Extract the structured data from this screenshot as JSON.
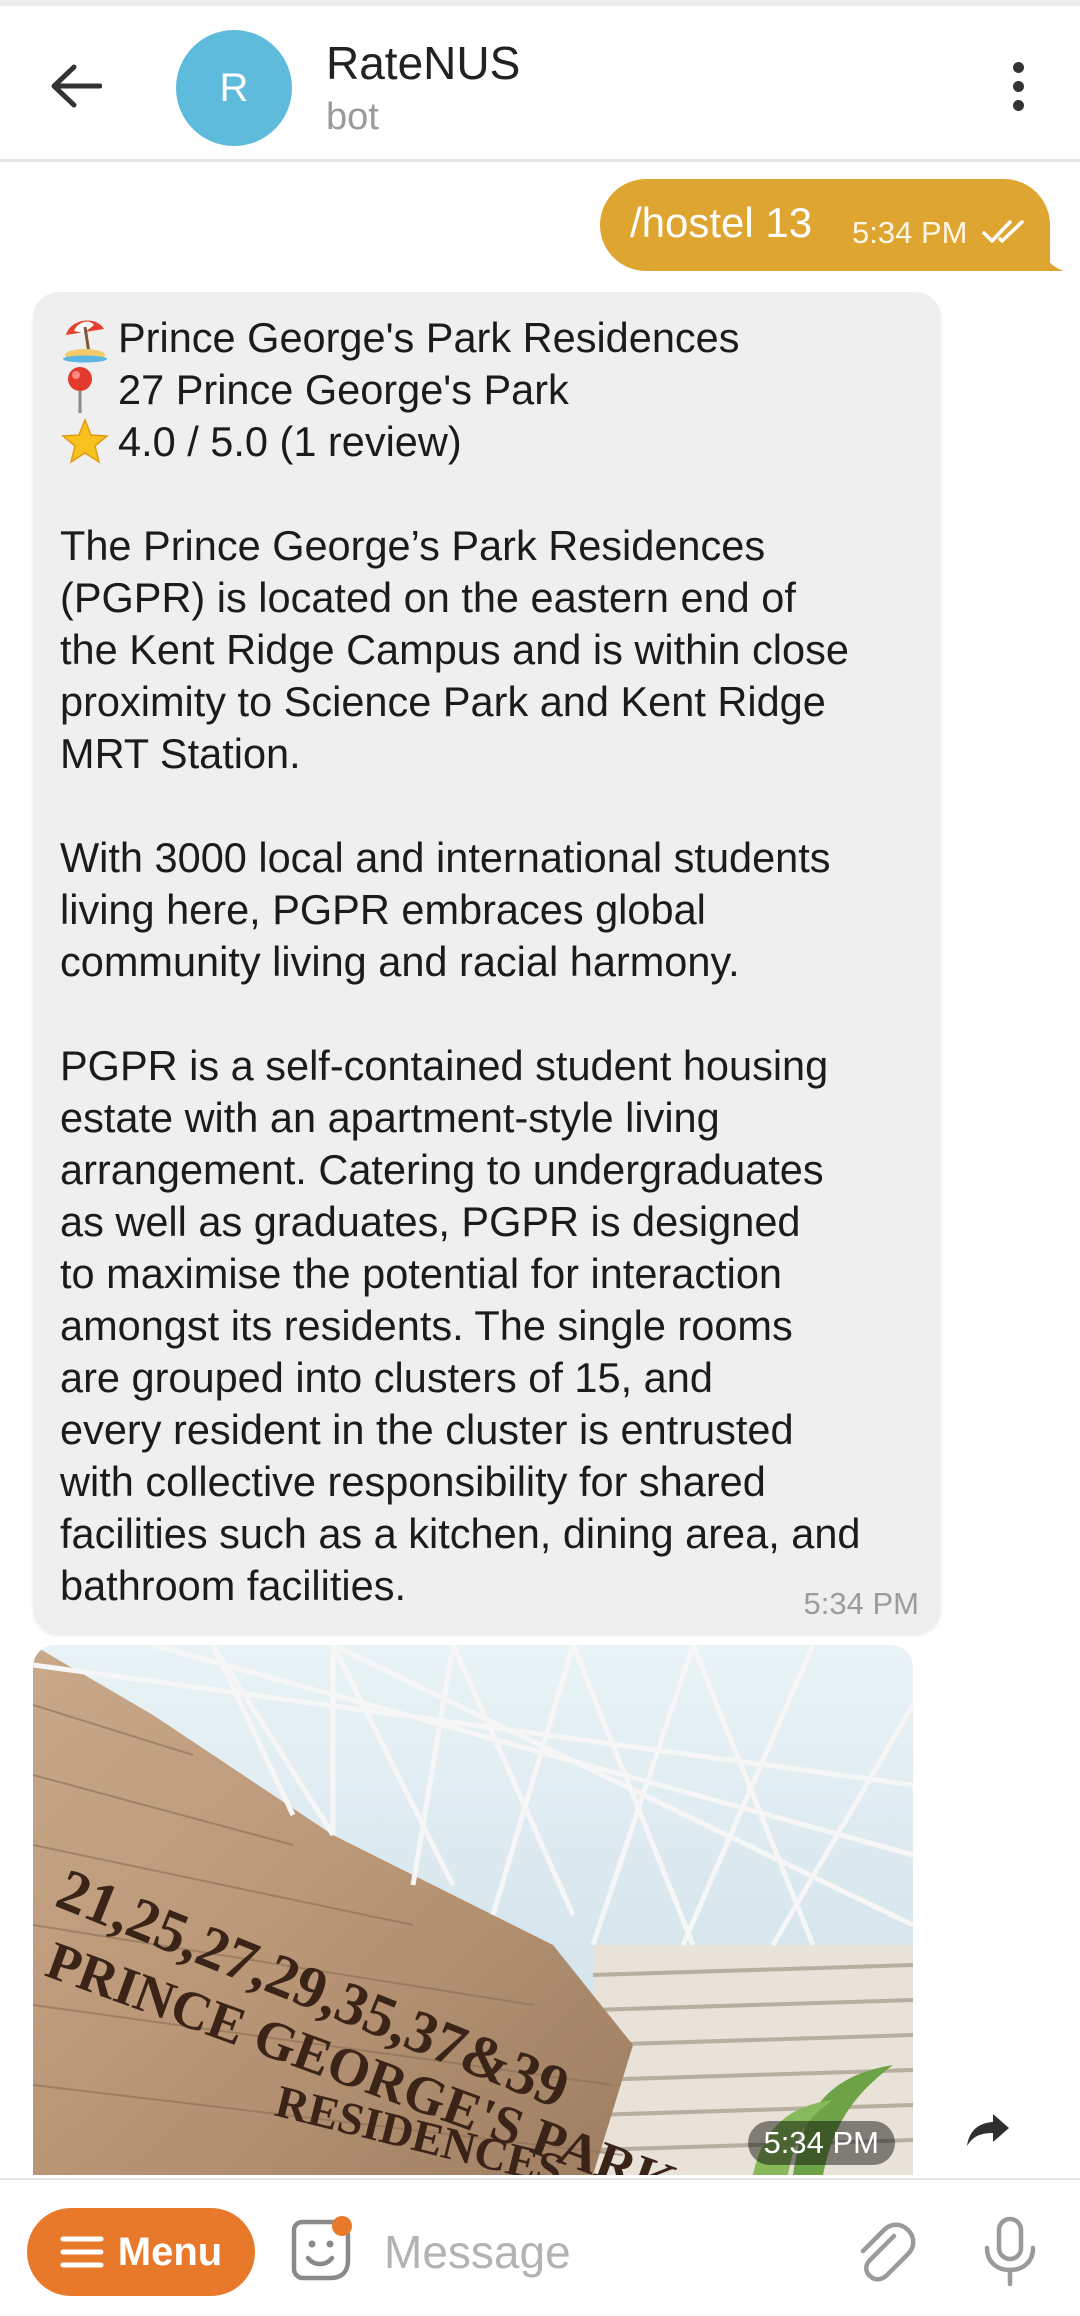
{
  "header": {
    "back_icon": "arrow-left-icon",
    "avatar_letter": "R",
    "avatar_color": "#5fbbdc",
    "title": "RateNUS",
    "subtitle": "bot",
    "more_icon": "more-vertical-icon"
  },
  "messages": {
    "outgoing": {
      "text": "/hostel 13",
      "time": "5:34 PM",
      "status_icon": "double-check-icon",
      "bubble_color": "#dfa531"
    },
    "incoming": {
      "name_emoji": "beach-umbrella-emoji",
      "name": "Prince George's Park Residences",
      "address_emoji": "round-pushpin-emoji",
      "address": "27 Prince George's Park",
      "rating_emoji": "star-emoji",
      "rating": "4.0 / 5.0 (1 review)",
      "paragraph_1": "The Prince George’s Park Residences\n(PGPR) is located on the eastern end of\nthe Kent Ridge Campus and is within close\nproximity to Science Park and Kent Ridge\nMRT Station.",
      "paragraph_2": "With 3000 local and international students\nliving here, PGPR embraces global\ncommunity living and racial harmony.",
      "paragraph_3": "PGPR is a self-contained student housing\nestate with an apartment-style living\narrangement. Catering to undergraduates\nas well as graduates, PGPR is designed\nto maximise the potential for interaction\namongst its residents. The single rooms\nare grouped into clusters of 15, and\nevery resident in the cluster is entrusted\nwith collective responsibility for shared\nfacilities such as a kitchen, dining area, and\nbathroom facilities.",
      "time": "5:34 PM"
    },
    "photo": {
      "sign_line_1": "21,25,27,29,35,37&39",
      "sign_line_2": "PRINCE GEORGE'S PARK",
      "sign_line_3": "RESIDENCES",
      "time": "5:34 PM",
      "share_icon": "share-arrow-icon"
    }
  },
  "composer": {
    "menu_label": "Menu",
    "menu_color": "#e8792a",
    "sticker_icon": "sticker-icon",
    "placeholder": "Message",
    "attach_icon": "paperclip-icon",
    "mic_icon": "microphone-icon"
  }
}
